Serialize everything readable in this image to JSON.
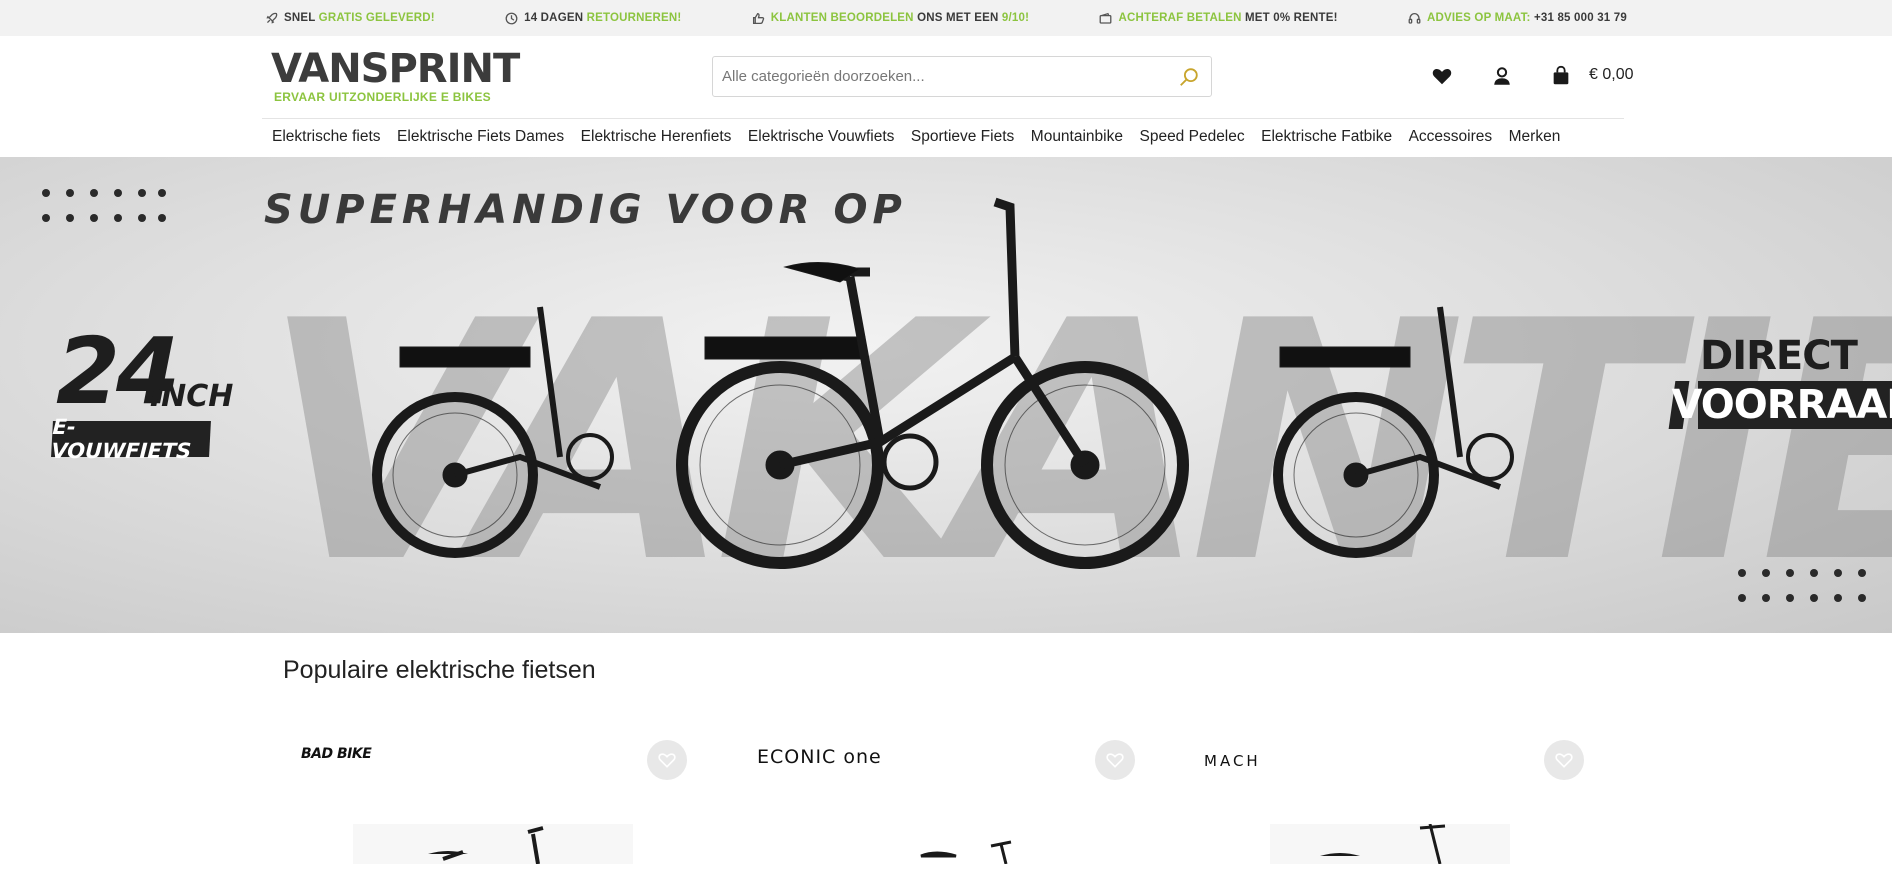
{
  "usp_bar": [
    {
      "icon": "rocket-icon",
      "pre": "Snel ",
      "highlight": "gratis geleverd!",
      "post": ""
    },
    {
      "icon": "clock-icon",
      "pre": "14 dagen ",
      "highlight": "retourneren!",
      "post": ""
    },
    {
      "icon": "thumbs-up-icon",
      "pre": "",
      "highlight": "Klanten beoordelen",
      "post": " ons met een ",
      "highlight2": "9/10!"
    },
    {
      "icon": "wallet-icon",
      "pre": "",
      "highlight": "Achteraf betalen",
      "post": " met 0% rente!"
    },
    {
      "icon": "headset-icon",
      "pre": "",
      "highlight": "Advies op maat:",
      "post": " +31 85 000 31 79"
    }
  ],
  "header": {
    "logo_main": "VANSPRINT",
    "logo_sub": "ERVAAR UITZONDERLIJKE E BIKES",
    "search_placeholder": "Alle categorieën doorzoeken...",
    "cart_total": "€ 0,00"
  },
  "nav": {
    "items": [
      "Elektrische fiets",
      "Elektrische Fiets Dames",
      "Elektrische Herenfiets",
      "Elektrische Vouwfiets",
      "Sportieve Fiets",
      "Mountainbike",
      "Speed Pedelec",
      "Elektrische Fatbike",
      "Accessoires",
      "Merken"
    ]
  },
  "banner": {
    "headline_top": "SUPERHANDIG VOOR OP",
    "headline_big": "VAKANTIE",
    "size_number": "24",
    "size_unit": "INCH",
    "size_label": "E-VOUWFIETS",
    "stock_top": "DIRECT OP",
    "stock_bottom": "VOORRAAD"
  },
  "popular": {
    "title": "Populaire elektrische fietsen",
    "products": [
      {
        "brand": "BAD BIKE"
      },
      {
        "brand": "ECONIC one"
      },
      {
        "brand": "MACH"
      }
    ]
  },
  "colors": {
    "accent_green": "#8cc43f",
    "search_icon_gold": "#c8a52d"
  }
}
